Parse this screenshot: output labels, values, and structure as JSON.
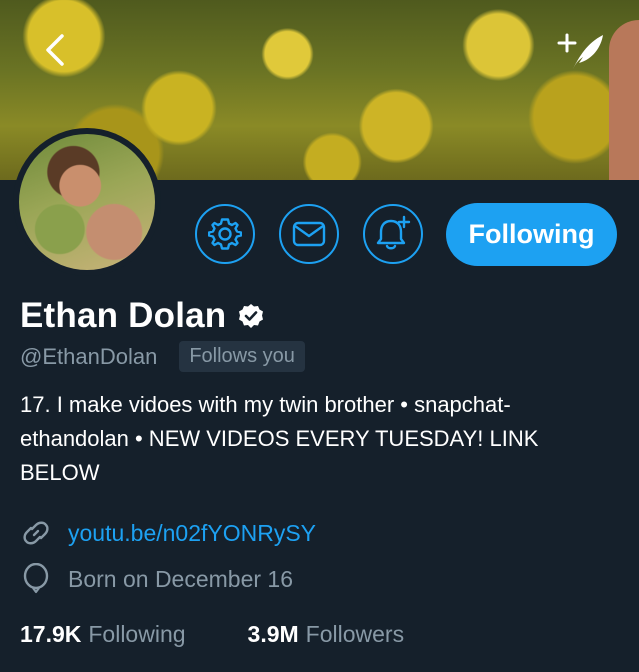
{
  "header": {
    "back_icon": "chevron-left-icon",
    "compose_icon": "compose-tweet-icon"
  },
  "actions": {
    "settings_icon": "gear-icon",
    "message_icon": "mail-icon",
    "notify_icon": "bell-plus-icon",
    "follow_label": "Following"
  },
  "profile": {
    "name": "Ethan Dolan",
    "verified": true,
    "handle": "@EthanDolan",
    "follows_you": "Follows you",
    "bio_line1": "17. I make vidoes with my twin brother • snapchat-",
    "bio_line2": "ethandolan • NEW VIDEOS EVERY TUESDAY! LINK",
    "bio_line3": "BELOW",
    "link": "youtu.be/n02fYONRySY",
    "birthday": "Born on December 16"
  },
  "stats": {
    "following_count": "17.9K",
    "following_label": "Following",
    "followers_count": "3.9M",
    "followers_label": "Followers"
  },
  "colors": {
    "background": "#15202b",
    "accent": "#1da1f2",
    "secondary_text": "#8899a6"
  }
}
